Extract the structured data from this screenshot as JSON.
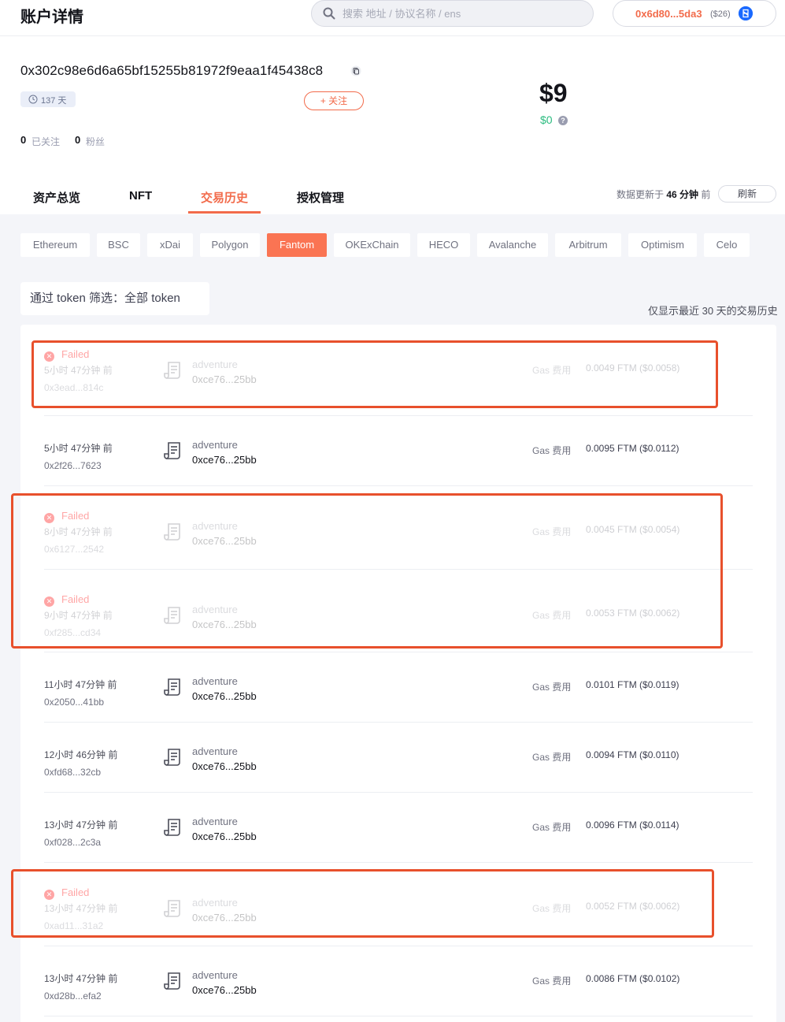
{
  "header": {
    "title": "账户详情",
    "search_placeholder": "搜索 地址 / 协议名称 / ens",
    "account_address": "0x6d80...5da3",
    "account_usd": "($26)"
  },
  "profile": {
    "address": "0x302c98e6d6a65bf15255b81972f9eaa1f45438c8",
    "days": "137 天",
    "follow_label": "+ 关注",
    "net_worth": "$9",
    "change": "$0",
    "following_count": "0",
    "following_label": "已关注",
    "followers_count": "0",
    "followers_label": "粉丝"
  },
  "tabs": [
    {
      "label": "资产总览"
    },
    {
      "label": "NFT"
    },
    {
      "label": "交易历史"
    },
    {
      "label": "授权管理"
    }
  ],
  "update": {
    "prefix": "数据更新于",
    "time": "46 分钟",
    "suffix": "前",
    "refresh_label": "刷新"
  },
  "chains": [
    "Ethereum",
    "BSC",
    "xDai",
    "Polygon",
    "Fantom",
    "OKExChain",
    "HECO",
    "Avalanche",
    "Arbitrum",
    "Optimism",
    "Celo"
  ],
  "active_chain": "Fantom",
  "filter": {
    "label": "通过 token 筛选：全部 token"
  },
  "recent_note": "仅显示最近 30 天的交易历史",
  "gas_label": "Gas 费用",
  "failed_label": "Failed",
  "transactions": [
    {
      "failed": true,
      "time": "5小时 47分钟 前",
      "hash": "0x3ead...814c",
      "method": "adventure",
      "contract": "0xce76...25bb",
      "gas": "0.0049 FTM ($0.0058)"
    },
    {
      "failed": false,
      "time": "5小时 47分钟 前",
      "hash": "0x2f26...7623",
      "method": "adventure",
      "contract": "0xce76...25bb",
      "gas": "0.0095 FTM ($0.0112)"
    },
    {
      "failed": true,
      "time": "8小时 47分钟 前",
      "hash": "0x6127...2542",
      "method": "adventure",
      "contract": "0xce76...25bb",
      "gas": "0.0045 FTM ($0.0054)"
    },
    {
      "failed": true,
      "time": "9小时 47分钟 前",
      "hash": "0xf285...cd34",
      "method": "adventure",
      "contract": "0xce76...25bb",
      "gas": "0.0053 FTM ($0.0062)"
    },
    {
      "failed": false,
      "time": "11小时 47分钟 前",
      "hash": "0x2050...41bb",
      "method": "adventure",
      "contract": "0xce76...25bb",
      "gas": "0.0101 FTM ($0.0119)"
    },
    {
      "failed": false,
      "time": "12小时 46分钟 前",
      "hash": "0xfd68...32cb",
      "method": "adventure",
      "contract": "0xce76...25bb",
      "gas": "0.0094 FTM ($0.0110)"
    },
    {
      "failed": false,
      "time": "13小时 47分钟 前",
      "hash": "0xf028...2c3a",
      "method": "adventure",
      "contract": "0xce76...25bb",
      "gas": "0.0096 FTM ($0.0114)"
    },
    {
      "failed": true,
      "time": "13小时 47分钟 前",
      "hash": "0xad11...31a2",
      "method": "adventure",
      "contract": "0xce76...25bb",
      "gas": "0.0052 FTM ($0.0062)"
    },
    {
      "failed": false,
      "time": "13小时 47分钟 前",
      "hash": "0xd28b...efa2",
      "method": "adventure",
      "contract": "0xce76...25bb",
      "gas": "0.0086 FTM ($0.0102)"
    }
  ],
  "colors": {
    "accent": "#f26b4b",
    "active_chain": "#fa7453",
    "positive": "#2abb7f",
    "failed": "#ff5d5d",
    "highlight": "#e8502c"
  }
}
